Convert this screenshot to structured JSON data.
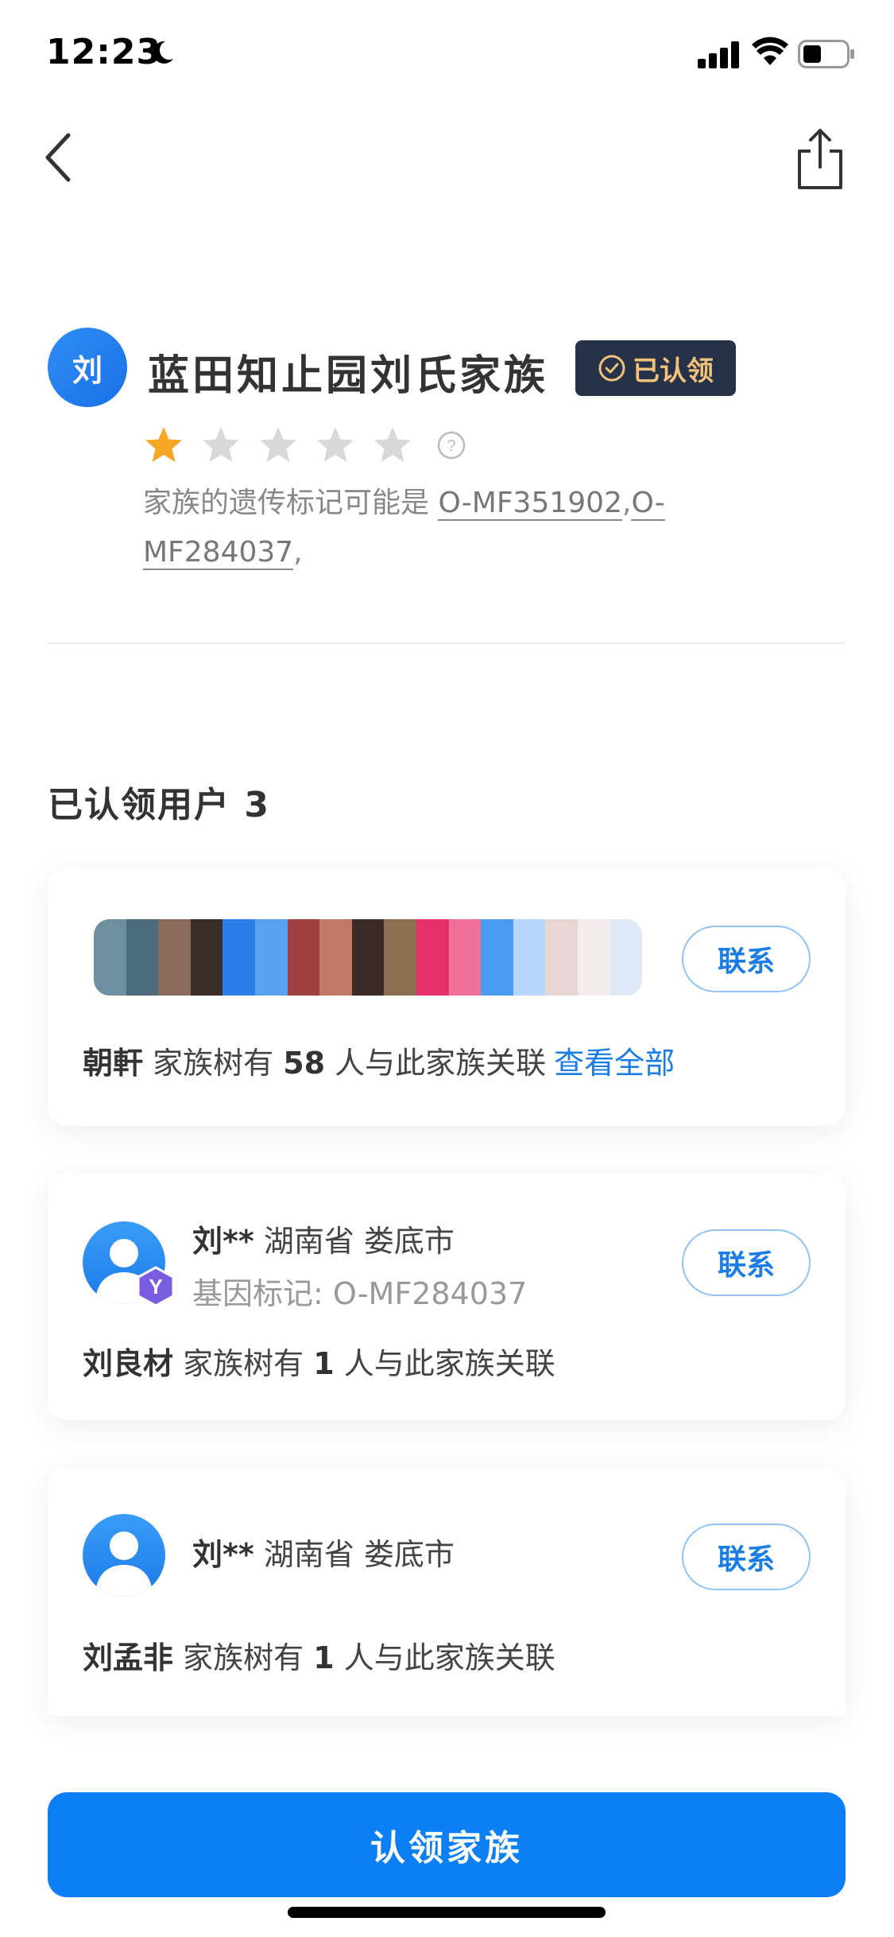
{
  "status_bar": {
    "time": "12:23"
  },
  "header": {
    "avatar_char": "刘",
    "family_name": "蓝田知止园刘氏家族",
    "badge": "已认领",
    "rating": 1,
    "rating_max": 5,
    "marker_prefix": "家族的遗传标记可能是 ",
    "marker_1": "O-MF351902",
    "marker_sep": ",",
    "marker_2": "O-MF284037",
    "marker_end": ","
  },
  "section": {
    "title": "已认领用户 3"
  },
  "cards": [
    {
      "name": "朝軒",
      "tree_mid": " 家族树有 ",
      "count": "58",
      "tree_end": " 人与此家族关联",
      "view_all": "查看全部",
      "contact": "联系"
    },
    {
      "user": "刘**",
      "location": " 湖南省 娄底市",
      "gene": "基因标记: O-MF284037",
      "badge_letter": "Y",
      "name": "刘良材",
      "tree_mid": " 家族树有 ",
      "count": "1",
      "tree_end": " 人与此家族关联",
      "contact": "联系"
    },
    {
      "user": "刘**",
      "location": " 湖南省 娄底市",
      "name": "刘孟非",
      "tree_mid": " 家族树有 ",
      "count": "1",
      "tree_end": " 人与此家族关联",
      "contact": "联系"
    }
  ],
  "footer": {
    "claim_label": "认领家族"
  },
  "colors": {
    "primary": "#0d7ff5",
    "badge_bg": "#263248",
    "badge_text": "#f3c27a",
    "star_active": "#f5a623",
    "star_inactive": "#d8d8d8"
  }
}
